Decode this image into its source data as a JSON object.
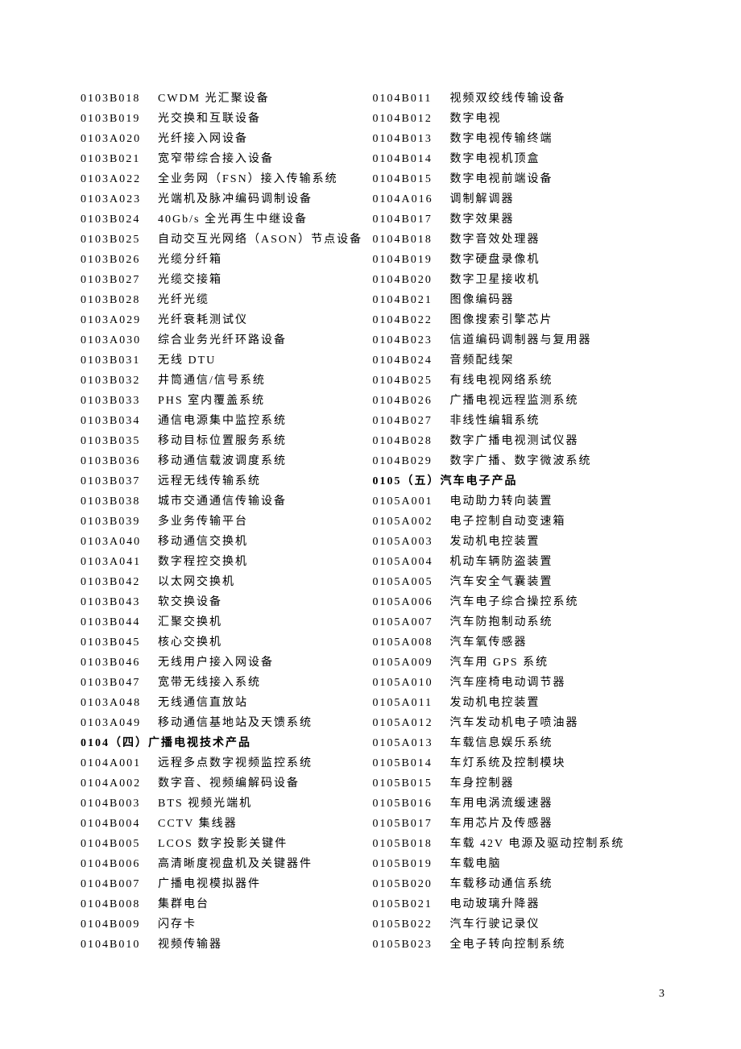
{
  "pageNumber": "3",
  "leftColumn": [
    {
      "code": "0103B018",
      "desc": "CWDM 光汇聚设备"
    },
    {
      "code": "0103B019",
      "desc": "光交换和互联设备"
    },
    {
      "code": "0103A020",
      "desc": "光纤接入网设备"
    },
    {
      "code": "0103B021",
      "desc": "宽窄带综合接入设备"
    },
    {
      "code": "0103A022",
      "desc": "全业务网（FSN）接入传输系统"
    },
    {
      "code": "0103A023",
      "desc": "光端机及脉冲编码调制设备"
    },
    {
      "code": "0103B024",
      "desc": "40Gb/s 全光再生中继设备"
    },
    {
      "code": "0103B025",
      "desc": "自动交互光网络（ASON）节点设备"
    },
    {
      "code": "0103B026",
      "desc": "光缆分纤箱"
    },
    {
      "code": "0103B027",
      "desc": "光缆交接箱"
    },
    {
      "code": "0103B028",
      "desc": "光纤光缆"
    },
    {
      "code": "0103A029",
      "desc": "光纤衰耗测试仪"
    },
    {
      "code": "0103A030",
      "desc": "综合业务光纤环路设备"
    },
    {
      "code": "0103B031",
      "desc": "无线 DTU"
    },
    {
      "code": "0103B032",
      "desc": "井筒通信/信号系统"
    },
    {
      "code": "0103B033",
      "desc": "PHS 室内覆盖系统"
    },
    {
      "code": "0103B034",
      "desc": "通信电源集中监控系统"
    },
    {
      "code": "0103B035",
      "desc": "移动目标位置服务系统"
    },
    {
      "code": "0103B036",
      "desc": "移动通信载波调度系统"
    },
    {
      "code": "0103B037",
      "desc": "远程无线传输系统"
    },
    {
      "code": "0103B038",
      "desc": "城市交通通信传输设备"
    },
    {
      "code": "0103B039",
      "desc": "多业务传输平台"
    },
    {
      "code": "0103A040",
      "desc": "移动通信交换机"
    },
    {
      "code": "0103A041",
      "desc": "数字程控交换机"
    },
    {
      "code": "0103B042",
      "desc": "以太网交换机"
    },
    {
      "code": "0103B043",
      "desc": "软交换设备"
    },
    {
      "code": "0103B044",
      "desc": "汇聚交换机"
    },
    {
      "code": "0103B045",
      "desc": "核心交换机"
    },
    {
      "code": "0103B046",
      "desc": "无线用户接入网设备"
    },
    {
      "code": "0103B047",
      "desc": "宽带无线接入系统"
    },
    {
      "code": "0103A048",
      "desc": "无线通信直放站"
    },
    {
      "code": "0103A049",
      "desc": "移动通信基地站及天馈系统"
    },
    {
      "heading": true,
      "text": "0104（四）广播电视技术产品"
    },
    {
      "code": "0104A001",
      "desc": "远程多点数字视频监控系统"
    },
    {
      "code": "0104A002",
      "desc": "数字音、视频编解码设备"
    },
    {
      "code": "0104B003",
      "desc": "BTS 视频光端机"
    },
    {
      "code": "0104B004",
      "desc": "CCTV 集线器"
    },
    {
      "code": "0104B005",
      "desc": "LCOS 数字投影关键件"
    },
    {
      "code": "0104B006",
      "desc": "高清晰度视盘机及关键器件"
    },
    {
      "code": "0104B007",
      "desc": "广播电视模拟器件"
    },
    {
      "code": "0104B008",
      "desc": "集群电台"
    },
    {
      "code": "0104B009",
      "desc": "闪存卡"
    },
    {
      "code": "0104B010",
      "desc": "视频传输器"
    }
  ],
  "rightColumn": [
    {
      "code": "0104B011",
      "desc": "视频双绞线传输设备"
    },
    {
      "code": "0104B012",
      "desc": "数字电视"
    },
    {
      "code": "0104B013",
      "desc": "数字电视传输终端"
    },
    {
      "code": "0104B014",
      "desc": "数字电视机顶盒"
    },
    {
      "code": "0104B015",
      "desc": "数字电视前端设备"
    },
    {
      "code": "0104A016",
      "desc": "调制解调器"
    },
    {
      "code": "0104B017",
      "desc": "数字效果器"
    },
    {
      "code": "0104B018",
      "desc": "数字音效处理器"
    },
    {
      "code": "0104B019",
      "desc": "数字硬盘录像机"
    },
    {
      "code": "0104B020",
      "desc": "数字卫星接收机"
    },
    {
      "code": "0104B021",
      "desc": "图像编码器"
    },
    {
      "code": "0104B022",
      "desc": "图像搜索引擎芯片"
    },
    {
      "code": "0104B023",
      "desc": "信道编码调制器与复用器"
    },
    {
      "code": "0104B024",
      "desc": "音频配线架"
    },
    {
      "code": "0104B025",
      "desc": "有线电视网络系统"
    },
    {
      "code": "0104B026",
      "desc": "广播电视远程监测系统"
    },
    {
      "code": "0104B027",
      "desc": "非线性编辑系统"
    },
    {
      "code": "0104B028",
      "desc": "数字广播电视测试仪器"
    },
    {
      "code": "0104B029",
      "desc": "数字广播、数字微波系统"
    },
    {
      "heading": true,
      "text": "0105（五）汽车电子产品"
    },
    {
      "code": "0105A001",
      "desc": "电动助力转向装置"
    },
    {
      "code": "0105A002",
      "desc": "电子控制自动变速箱"
    },
    {
      "code": "0105A003",
      "desc": "发动机电控装置"
    },
    {
      "code": "0105A004",
      "desc": "机动车辆防盗装置"
    },
    {
      "code": "0105A005",
      "desc": "汽车安全气囊装置"
    },
    {
      "code": "0105A006",
      "desc": "汽车电子综合操控系统"
    },
    {
      "code": "0105A007",
      "desc": "汽车防抱制动系统"
    },
    {
      "code": "0105A008",
      "desc": "汽车氧传感器"
    },
    {
      "code": "0105A009",
      "desc": "汽车用 GPS 系统"
    },
    {
      "code": "0105A010",
      "desc": "汽车座椅电动调节器"
    },
    {
      "code": "0105A011",
      "desc": "发动机电控装置"
    },
    {
      "code": "0105A012",
      "desc": "汽车发动机电子喷油器"
    },
    {
      "code": "0105A013",
      "desc": "车载信息娱乐系统"
    },
    {
      "code": "0105B014",
      "desc": "车灯系统及控制模块"
    },
    {
      "code": "0105B015",
      "desc": "车身控制器"
    },
    {
      "code": "0105B016",
      "desc": "车用电涡流缓速器"
    },
    {
      "code": "0105B017",
      "desc": "车用芯片及传感器"
    },
    {
      "code": "0105B018",
      "desc": "车载 42V 电源及驱动控制系统"
    },
    {
      "code": "0105B019",
      "desc": "车载电脑"
    },
    {
      "code": "0105B020",
      "desc": "车载移动通信系统"
    },
    {
      "code": "0105B021",
      "desc": "电动玻璃升降器"
    },
    {
      "code": "0105B022",
      "desc": "汽车行驶记录仪"
    },
    {
      "code": "0105B023",
      "desc": "全电子转向控制系统"
    }
  ]
}
